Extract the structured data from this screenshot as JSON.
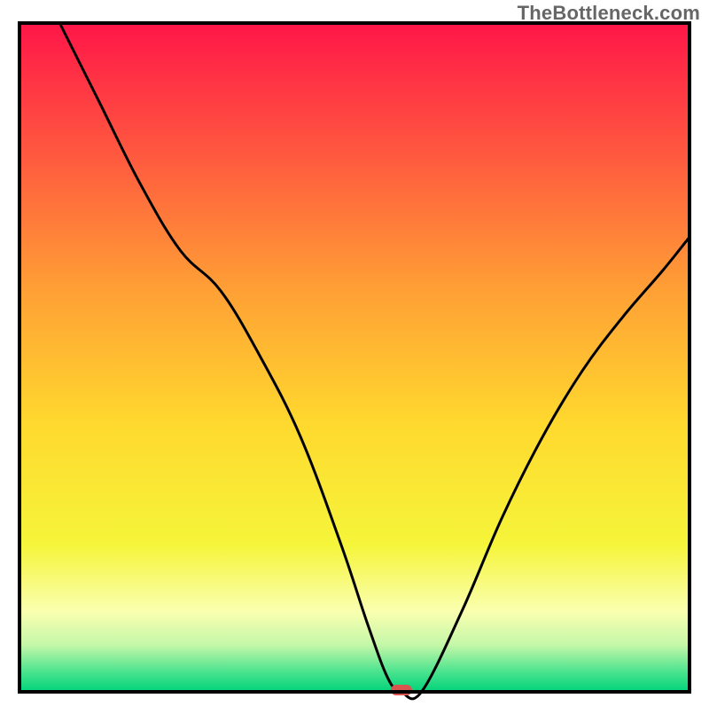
{
  "watermark": "TheBottleneck.com",
  "chart_data": {
    "type": "line",
    "title": "",
    "xlabel": "",
    "ylabel": "",
    "xlim": [
      0,
      100
    ],
    "ylim": [
      0,
      100
    ],
    "legend_position": "none",
    "grid": false,
    "background_gradient": {
      "type": "linear-vertical",
      "stops": [
        {
          "pos": 0.0,
          "color": "#ff1648"
        },
        {
          "pos": 0.2,
          "color": "#ff5a3f"
        },
        {
          "pos": 0.4,
          "color": "#ffa035"
        },
        {
          "pos": 0.6,
          "color": "#ffd92e"
        },
        {
          "pos": 0.78,
          "color": "#f5f53a"
        },
        {
          "pos": 0.88,
          "color": "#faffb0"
        },
        {
          "pos": 0.93,
          "color": "#c4f7a8"
        },
        {
          "pos": 0.97,
          "color": "#4be38e"
        },
        {
          "pos": 1.0,
          "color": "#00d37a"
        }
      ]
    },
    "marker": {
      "x": 57,
      "y": 0,
      "color": "#d9534f",
      "shape": "pill"
    },
    "series": [
      {
        "name": "bottleneck-curve",
        "x": [
          6,
          12,
          18,
          24,
          30,
          36,
          42,
          48,
          52,
          55,
          57,
          60,
          66,
          72,
          78,
          84,
          90,
          96,
          100
        ],
        "values": [
          100,
          88,
          76,
          66,
          60,
          50,
          38,
          22,
          10,
          2,
          0,
          0,
          12,
          26,
          38,
          48,
          56,
          63,
          68
        ]
      }
    ]
  }
}
